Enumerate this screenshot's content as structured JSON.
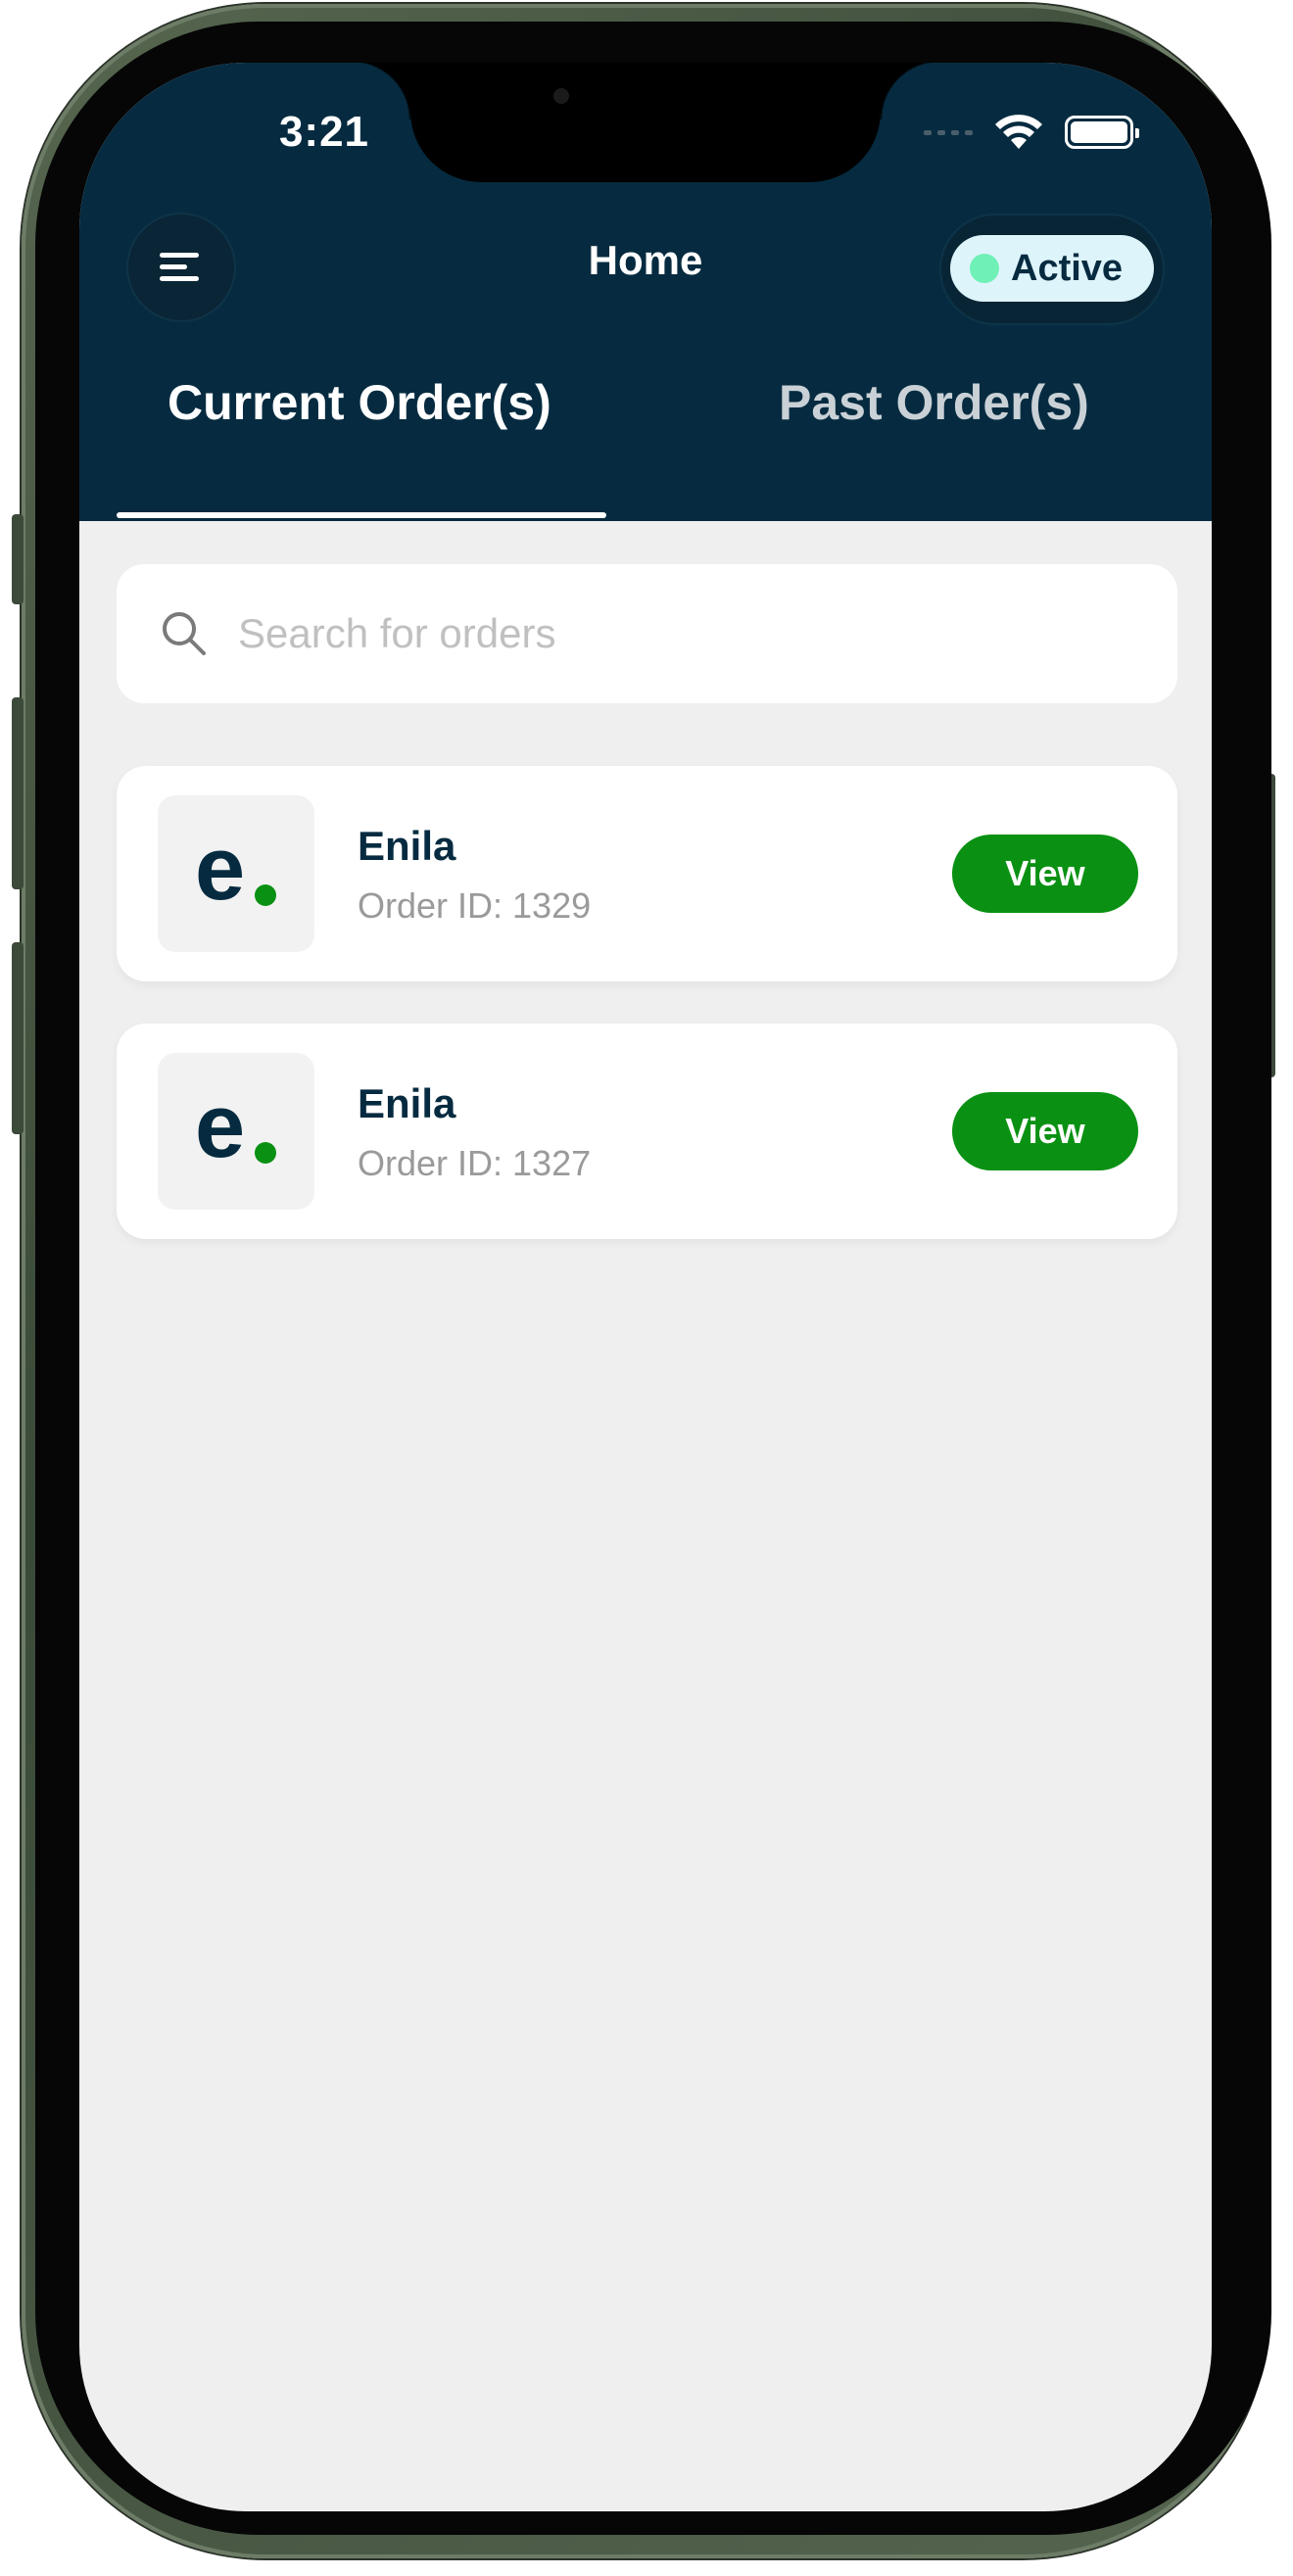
{
  "status_bar": {
    "time": "3:21"
  },
  "header": {
    "title": "Home",
    "menu_icon": "menu-icon",
    "status_toggle": {
      "label": "Active",
      "dot_color": "#6ff0b6"
    }
  },
  "tabs": [
    {
      "label": "Current Order(s)",
      "selected": true
    },
    {
      "label": "Past Order(s)",
      "selected": false
    }
  ],
  "search": {
    "placeholder": "Search for orders",
    "value": "",
    "icon": "search-icon"
  },
  "orders": [
    {
      "name": "Enila",
      "order_id": "Order ID: 1329",
      "action_label": "View",
      "logo_text": "e"
    },
    {
      "name": "Enila",
      "order_id": "Order ID: 1327",
      "action_label": "View",
      "logo_text": "e"
    }
  ],
  "colors": {
    "header_bg": "#062b40",
    "accent_green": "#0a9113",
    "page_bg": "#efefef"
  }
}
